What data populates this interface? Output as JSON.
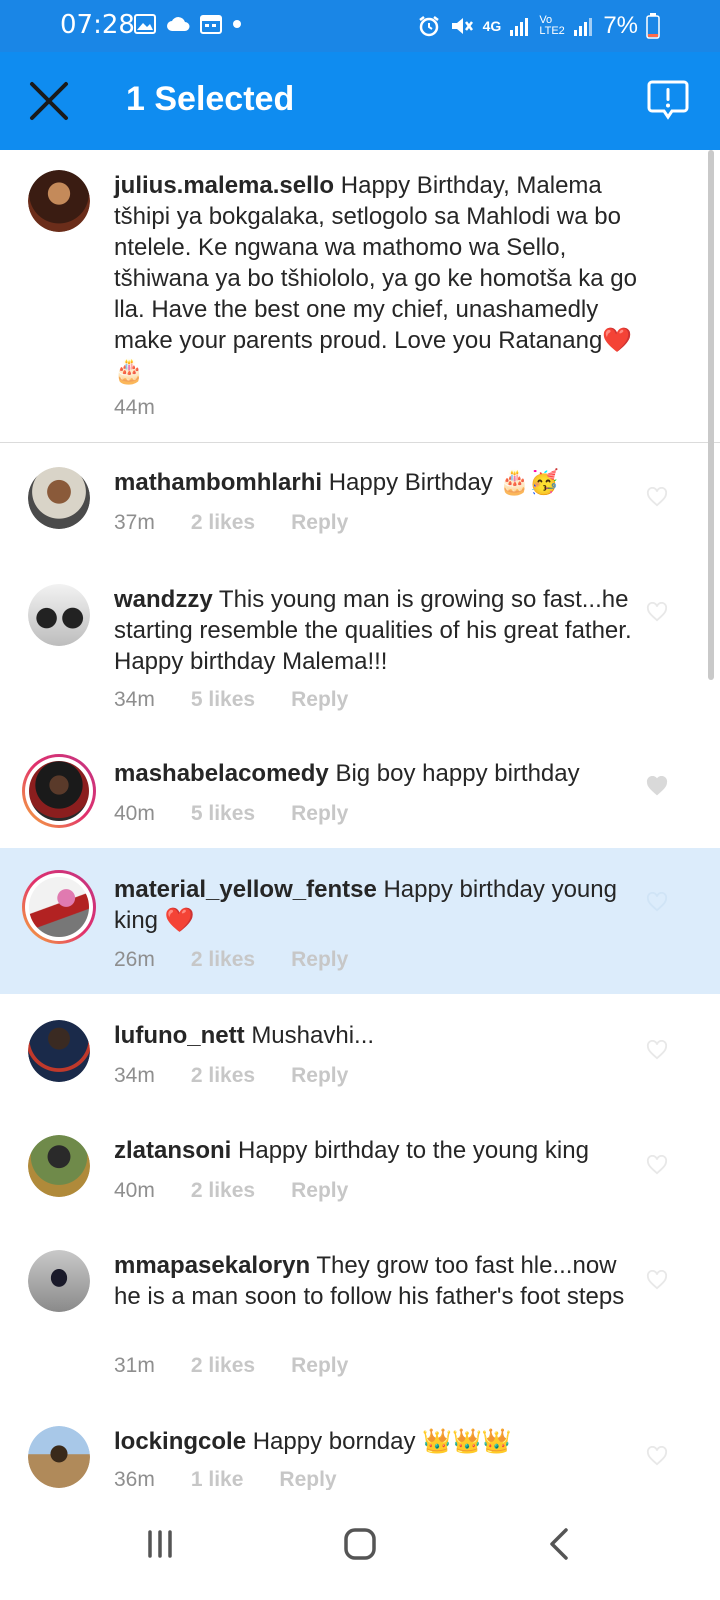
{
  "status_bar": {
    "time": "07:28",
    "network": "4G",
    "volte": "Vo LTE2",
    "battery": "7%",
    "icons": [
      "image-icon",
      "cloud-icon",
      "calendar-icon",
      "dot-icon",
      "alarm-icon",
      "mute-icon",
      "signal-icon",
      "battery-icon"
    ]
  },
  "app_bar": {
    "title": "1 Selected",
    "close_icon": "close-icon",
    "report_icon": "report-icon",
    "background": "#0f8cf0"
  },
  "caption": {
    "username": "julius.malema.sello",
    "text": "Happy Birthday, Malema tšhipi ya bokgalaka, setlogolo sa Mahlodi wa bo ntelele. Ke ngwana wa mathomo wa Sello, tšhiwana ya bo tšhiololo, ya go ke homotša ka go lla. Have the best one my chief, unashamedly make your parents proud. Love you Ratanang❤️🎂",
    "time": "44m"
  },
  "comments": [
    {
      "username": "mathambomhlarhi",
      "text": "Happy Birthday 🎂🥳",
      "time": "37m",
      "likes": "2 likes",
      "reply": "Reply",
      "liked": false
    },
    {
      "username": "wandzzy",
      "text": "This young man is growing so fast...he starting resemble the qualities of his great father. Happy birthday Malema!!!",
      "time": "34m",
      "likes": "5 likes",
      "reply": "Reply",
      "liked": false
    },
    {
      "username": "mashabelacomedy",
      "text": "Big boy happy birthday",
      "time": "40m",
      "likes": "5 likes",
      "reply": "Reply",
      "liked": true
    },
    {
      "username": "material_yellow_fentse",
      "text": "Happy birthday young king ❤️",
      "time": "26m",
      "likes": "2 likes",
      "reply": "Reply",
      "liked": false,
      "selected": true
    },
    {
      "username": "lufuno_nett",
      "text": "Mushavhi...",
      "time": "34m",
      "likes": "2 likes",
      "reply": "Reply",
      "liked": false
    },
    {
      "username": "zlatansoni",
      "text": "Happy birthday to the young king",
      "time": "40m",
      "likes": "2 likes",
      "reply": "Reply",
      "liked": false
    },
    {
      "username": "mmapasekaloryn",
      "text": "They grow too fast hle...now he is a man soon to follow his father's foot steps",
      "time": "31m",
      "likes": "2 likes",
      "reply": "Reply",
      "liked": false
    },
    {
      "username": "lockingcole",
      "text": "Happy bornday 👑👑👑",
      "time": "36m",
      "likes": "1 like",
      "reply": "Reply",
      "liked": false
    }
  ],
  "nav_bar": {
    "icons": [
      "recents-icon",
      "home-icon",
      "back-icon"
    ]
  }
}
